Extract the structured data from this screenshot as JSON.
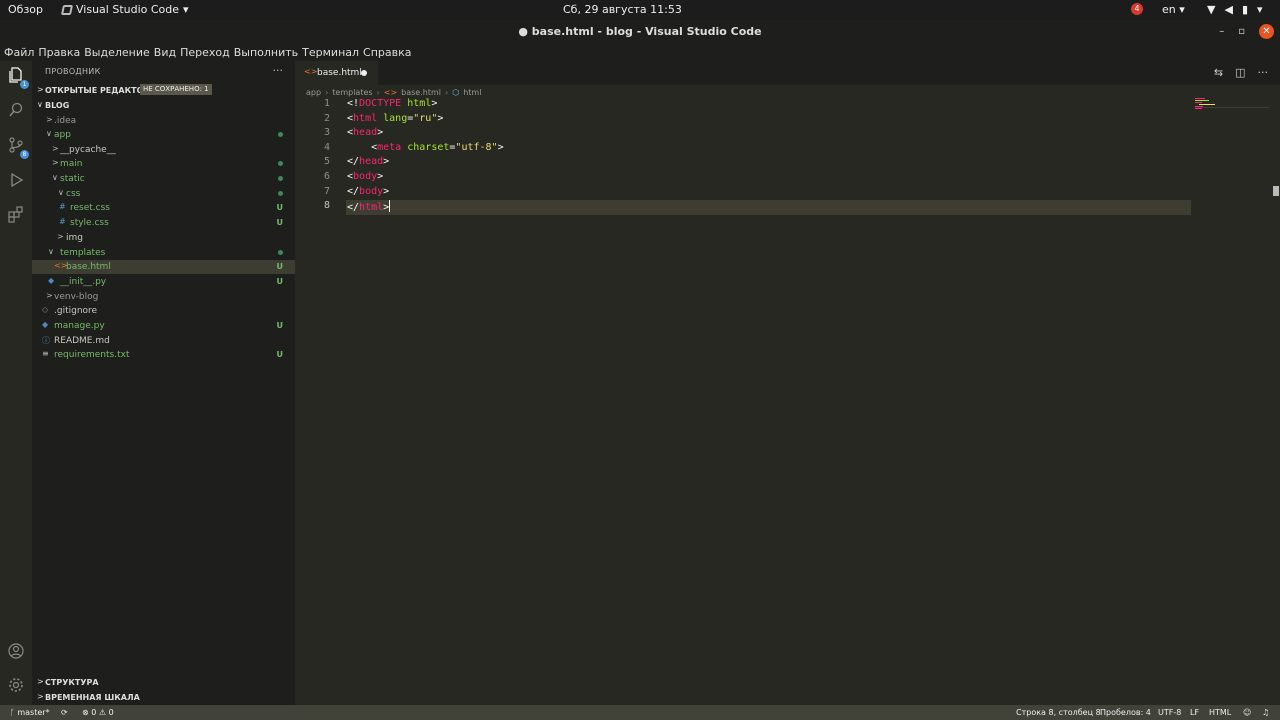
{
  "system_bar": {
    "activities": "Обзор",
    "app_name": "Visual Studio Code",
    "app_caret": "▾",
    "clock": "Сб, 29 августа  11:53",
    "notification_count": "4",
    "language": "en",
    "language_caret": "▾"
  },
  "window": {
    "title": "● base.html - blog - Visual Studio Code",
    "minimize": "–",
    "maximize": "▫",
    "close": "✕"
  },
  "menu": [
    "Файл",
    "Правка",
    "Выделение",
    "Вид",
    "Переход",
    "Выполнить",
    "Терминал",
    "Справка"
  ],
  "activity_bar": {
    "explorer_badge": "1",
    "scm_badge": "8"
  },
  "sidebar": {
    "title": "ПРОВОДНИК",
    "more": "···",
    "open_editors": {
      "label": "ОТКРЫТЫЕ РЕДАКТОРЫ",
      "badge": "НЕ СОХРАНЕНО: 1"
    },
    "workspace": "BLOG",
    "tree": [
      {
        "label": ".idea",
        "status": ""
      },
      {
        "label": "app",
        "status": ""
      },
      {
        "label": "__pycache__",
        "status": ""
      },
      {
        "label": "main",
        "status": ""
      },
      {
        "label": "static",
        "status": ""
      },
      {
        "label": "css",
        "status": ""
      },
      {
        "label": "reset.css",
        "status": "U"
      },
      {
        "label": "style.css",
        "status": "U"
      },
      {
        "label": "img",
        "status": ""
      },
      {
        "label": "templates",
        "status": ""
      },
      {
        "label": "base.html",
        "status": "U"
      },
      {
        "label": "__init__.py",
        "status": "U"
      },
      {
        "label": "venv-blog",
        "status": ""
      },
      {
        "label": ".gitignore",
        "status": ""
      },
      {
        "label": "manage.py",
        "status": "U"
      },
      {
        "label": "README.md",
        "status": ""
      },
      {
        "label": "requirements.txt",
        "status": "U"
      }
    ],
    "outline": "СТРУКТУРА",
    "timeline": "ВРЕМЕННАЯ ШКАЛА"
  },
  "editor": {
    "tab_label": "base.html",
    "breadcrumb": [
      "app",
      "templates",
      "base.html",
      "html"
    ],
    "line_numbers": [
      "1",
      "2",
      "3",
      "4",
      "5",
      "6",
      "7",
      "8"
    ],
    "code": {
      "l1_a": "<!",
      "l1_b": "DOCTYPE",
      "l1_c": " html",
      "l1_d": ">",
      "l2_a": "<",
      "l2_b": "html",
      "l2_c": " lang",
      "l2_d": "=",
      "l2_e": "\"ru\"",
      "l2_f": ">",
      "l3_a": "<",
      "l3_b": "head",
      "l3_c": ">",
      "l4_indent": "    ",
      "l4_a": "<",
      "l4_b": "meta",
      "l4_c": " charset",
      "l4_d": "=",
      "l4_e": "\"utf-8\"",
      "l4_f": ">",
      "l5_a": "</",
      "l5_b": "head",
      "l5_c": ">",
      "l6_a": "<",
      "l6_b": "body",
      "l6_c": ">",
      "l7_a": "</",
      "l7_b": "body",
      "l7_c": ">",
      "l8_a": "</",
      "l8_b": "html",
      "l8_c": ">"
    }
  },
  "status_bar": {
    "branch": "master*",
    "sync_icon": "⟳",
    "problems": "⊗ 0 ⚠ 0",
    "cursor_position": "Строка 8, столбец 8",
    "indent": "Пробелов: 4",
    "encoding": "UTF-8",
    "eol": "LF",
    "language_mode": "HTML"
  },
  "colors": {
    "editor_bg": "#272822",
    "sidebar_bg": "#1e1f1c",
    "tag": "#f92672",
    "attribute": "#a6e22e",
    "string": "#e6db74",
    "untracked": "#76b86b",
    "statusbar_bg": "#414339"
  }
}
